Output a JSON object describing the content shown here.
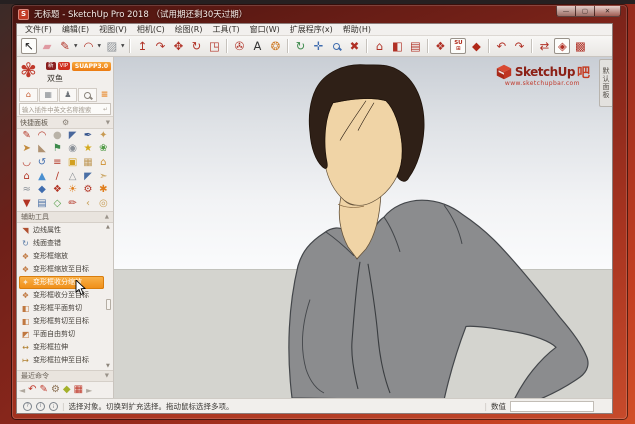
{
  "window": {
    "title": "无标题 - SketchUp Pro 2018 （试用期还剩30天过期）",
    "icon_label": "S",
    "controls": {
      "minimize": "—",
      "maximize": "▢",
      "close": "✕"
    }
  },
  "menu": {
    "items": [
      "文件(F)",
      "编辑(E)",
      "视图(V)",
      "相机(C)",
      "绘图(R)",
      "工具(T)",
      "窗口(W)",
      "扩展程序(x)",
      "帮助(H)"
    ]
  },
  "toolbar": {
    "icons": [
      {
        "name": "select-tool",
        "glyph": "↖",
        "color": "#1a1a1a",
        "boxed": true
      },
      {
        "name": "eraser-tool",
        "glyph": "▰",
        "color": "#e09aa2"
      },
      {
        "name": "line-tool",
        "glyph": "✎",
        "color": "#b03025",
        "dd": true
      },
      {
        "name": "arc-tool",
        "glyph": "◠",
        "color": "#b03025",
        "dd": true
      },
      {
        "name": "rectangle-tool",
        "glyph": "▨",
        "color": "#8a8f94",
        "dd": true
      },
      {
        "sep": true
      },
      {
        "name": "pushpull-tool",
        "glyph": "↥",
        "color": "#b03025"
      },
      {
        "name": "followme-tool",
        "glyph": "↷",
        "color": "#b03025"
      },
      {
        "name": "move-tool",
        "glyph": "✥",
        "color": "#b03025"
      },
      {
        "name": "rotate-tool",
        "glyph": "↻",
        "color": "#b03025"
      },
      {
        "name": "scale-tool",
        "glyph": "◳",
        "color": "#b03025"
      },
      {
        "sep": true
      },
      {
        "name": "tape-measure-tool",
        "glyph": "✇",
        "color": "#b03025"
      },
      {
        "name": "text-tool",
        "glyph": "A",
        "color": "#333333"
      },
      {
        "name": "paint-tool",
        "glyph": "❂",
        "color": "#d08030"
      },
      {
        "sep": true
      },
      {
        "name": "orbit-tool",
        "glyph": "↻",
        "color": "#3d8a4c"
      },
      {
        "name": "pan-tool",
        "glyph": "✛",
        "color": "#3f6cae"
      },
      {
        "name": "zoom-tool",
        "mag": "blue"
      },
      {
        "name": "zoom-extents-tool",
        "glyph": "✖",
        "color": "#b03025"
      },
      {
        "sep": true
      },
      {
        "name": "view-front",
        "glyph": "⌂",
        "color": "#b03025"
      },
      {
        "name": "view-iso",
        "glyph": "◧",
        "color": "#b03025"
      },
      {
        "name": "view-top",
        "glyph": "▤",
        "color": "#b03025"
      },
      {
        "sep": true
      },
      {
        "name": "styles-tool",
        "glyph": "❖",
        "color": "#b03025"
      },
      {
        "name": "suapp-panel-toggle",
        "su": true,
        "boxed": true
      },
      {
        "name": "suapp-cube",
        "glyph": "◆",
        "color": "#b02818"
      },
      {
        "sep": true
      },
      {
        "name": "undo-view",
        "glyph": "↶",
        "color": "#b03025"
      },
      {
        "name": "redo-view",
        "glyph": "↷",
        "color": "#b03025"
      },
      {
        "sep": true
      },
      {
        "name": "plugin-a",
        "glyph": "⇄",
        "color": "#b03025"
      },
      {
        "name": "plugin-b",
        "glyph": "◈",
        "color": "#b03025",
        "boxed": true
      },
      {
        "name": "plugin-c",
        "glyph": "▩",
        "color": "#b03025"
      }
    ]
  },
  "sidebar": {
    "logo_glyph": "✾",
    "badges": [
      "新",
      "VIP"
    ],
    "username": "双鱼",
    "version_button": "SUAPP3.0",
    "tabs": [
      {
        "name": "tab-home",
        "glyph": "⌂",
        "color": "#c4562a"
      },
      {
        "name": "tab-panel",
        "glyph": "▦",
        "color": "#8a8f94"
      },
      {
        "name": "tab-user",
        "glyph": "♟",
        "color": "#6f747a"
      },
      {
        "name": "tab-search",
        "mag": "gray"
      },
      {
        "name": "tab-menu",
        "glyph": "≡",
        "color": "#e8821e",
        "hamb": true
      }
    ],
    "search_placeholder": "输入插件中英文名称搜索",
    "search_return_glyph": "↵",
    "quick_panel_label": "快捷面板",
    "grid_icons": [
      {
        "g": "✎",
        "c": "#b23424"
      },
      {
        "g": "◠",
        "c": "#b23424"
      },
      {
        "g": "●",
        "c": "#b9b3a8"
      },
      {
        "g": "◤",
        "c": "#49679c"
      },
      {
        "g": "✒",
        "c": "#30508a"
      },
      {
        "g": "✦",
        "c": "#c89a52"
      },
      {
        "g": "➤",
        "c": "#c28a3c"
      },
      {
        "g": "◣",
        "c": "#b09272"
      },
      {
        "g": "⚑",
        "c": "#3d8a4c"
      },
      {
        "g": "◉",
        "c": "#8a9098"
      },
      {
        "g": "★",
        "c": "#d4a91c"
      },
      {
        "g": "❀",
        "c": "#4f9a44"
      },
      {
        "g": "◡",
        "c": "#b23424"
      },
      {
        "g": "↺",
        "c": "#3f6cae"
      },
      {
        "g": "≡",
        "c": "#b23424"
      },
      {
        "g": "▣",
        "c": "#d2a020"
      },
      {
        "g": "▦",
        "c": "#c09a5a"
      },
      {
        "g": "⌂",
        "c": "#cf8f2e"
      },
      {
        "g": "⌂",
        "c": "#b23424"
      },
      {
        "g": "▲",
        "c": "#4a8fd0"
      },
      {
        "g": "∕",
        "c": "#b23424"
      },
      {
        "g": "△",
        "c": "#8a8f94"
      },
      {
        "g": "◤",
        "c": "#4a6fa5"
      },
      {
        "g": "➣",
        "c": "#c8a05a"
      },
      {
        "g": "≈",
        "c": "#8a9098"
      },
      {
        "g": "◆",
        "c": "#3f6cae"
      },
      {
        "g": "❖",
        "c": "#b23424"
      },
      {
        "g": "☀",
        "c": "#e07f1e"
      },
      {
        "g": "⚙",
        "c": "#b23424"
      },
      {
        "g": "✱",
        "c": "#e07f1e"
      },
      {
        "g": "▼",
        "c": "#b23424"
      },
      {
        "g": "▤",
        "c": "#4a6fa5"
      },
      {
        "g": "◇",
        "c": "#56a04a"
      },
      {
        "g": "✏",
        "c": "#b23424"
      },
      {
        "g": "‹",
        "c": "#c8a05a"
      },
      {
        "g": "◎",
        "c": "#c8a05a"
      }
    ],
    "tools_section_label": "辅助工具",
    "tools": [
      {
        "label": "边线属性",
        "g": "◥",
        "c": "#b05030"
      },
      {
        "label": "线面查错",
        "g": "↻",
        "c": "#5a7ca8"
      },
      {
        "label": "变形框缩放",
        "g": "❖",
        "c": "#c07840"
      },
      {
        "label": "变形框缩放至目标",
        "g": "❖",
        "c": "#c07840"
      },
      {
        "label": "变形框收分缩放",
        "g": "✦",
        "c": "#f7e3c8",
        "hl": true
      },
      {
        "label": "变形框收分至目标",
        "g": "❖",
        "c": "#c07840"
      },
      {
        "label": "变形框平面剪切",
        "g": "◧",
        "c": "#c07840"
      },
      {
        "label": "变形框剪切至目标",
        "g": "◧",
        "c": "#c07840"
      },
      {
        "label": "平面自由剪切",
        "g": "◩",
        "c": "#c07840"
      },
      {
        "label": "变形框拉伸",
        "g": "↔",
        "c": "#b08030"
      },
      {
        "label": "变形框拉伸至目标",
        "g": "↦",
        "c": "#b08030"
      }
    ],
    "recent_section_label": "最近命令",
    "recent_icons": [
      {
        "g": "↶",
        "c": "#c0392b"
      },
      {
        "g": "✎",
        "c": "#c0392b"
      },
      {
        "g": "⚙",
        "c": "#8a6f52"
      },
      {
        "g": "◆",
        "c": "#a4b02a"
      },
      {
        "g": "▦",
        "c": "#c0392b"
      }
    ]
  },
  "canvas": {
    "watermark": {
      "brand": "SketchUp",
      "suffix": "吧",
      "url": "www.sketchupbar.com"
    },
    "right_tab_label": "默认面板"
  },
  "statusbar": {
    "icons": [
      "?",
      "i",
      "¡"
    ],
    "message": "选择对象。切换到扩充选择。拖动鼠标选择多项。",
    "value_label": "数值"
  }
}
